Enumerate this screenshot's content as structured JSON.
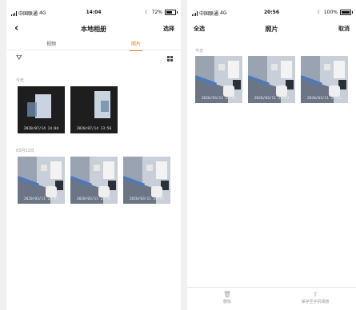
{
  "left": {
    "status": {
      "carrier": "中国联通",
      "network": "4G",
      "time": "14:04",
      "battery": "72%",
      "battery_level": 0.72
    },
    "nav": {
      "back_icon": "chevron-left-icon",
      "title": "本地相册",
      "action": "选择"
    },
    "tabs": [
      {
        "label": "视频",
        "active": false
      },
      {
        "label": "照片",
        "active": true
      }
    ],
    "sections": [
      {
        "label": "今天",
        "items": [
          {
            "timestamp": "2020/07/14 14:04"
          },
          {
            "timestamp": "2020/07/14 13:56"
          }
        ]
      },
      {
        "label": "03月11日",
        "items": [
          {
            "timestamp": "2020/03/11 20:47"
          },
          {
            "timestamp": "2020/03/11 20:47"
          },
          {
            "timestamp": "2020/03/11 20:47"
          }
        ]
      }
    ]
  },
  "right": {
    "status": {
      "carrier": "中国联通",
      "network": "4G",
      "time": "20:56",
      "battery": "100%",
      "battery_level": 1.0
    },
    "nav": {
      "left_action": "全选",
      "title": "照片",
      "action": "取消"
    },
    "sections": [
      {
        "label": "今天",
        "items": [
          {
            "timestamp": "2020/03/11 20:43"
          },
          {
            "timestamp": "2020/03/11 20:43"
          },
          {
            "timestamp": "2020/03/11 20:43"
          }
        ]
      }
    ],
    "bottom": {
      "delete": {
        "icon": "trash-icon",
        "label": "删除"
      },
      "save": {
        "icon": "upload-icon",
        "label": "保存至手机相册"
      }
    }
  }
}
